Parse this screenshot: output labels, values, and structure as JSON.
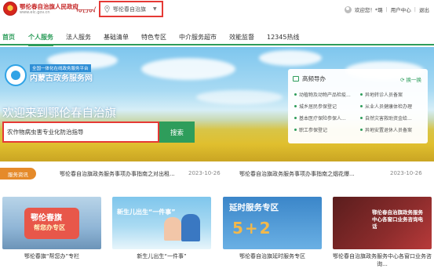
{
  "header": {
    "title": "鄂伦春自治旗人民政府",
    "url": "www.elc.gov.cn",
    "mongol_script": "ᠣᠷᠴᠣᠨ",
    "location": "鄂伦春自治旗",
    "greeting": "欢迎您！*璐",
    "user_center": "用户中心",
    "logout": "退出"
  },
  "nav": {
    "items": [
      "首页",
      "个人服务",
      "法人服务",
      "基础清单",
      "特色专区",
      "中介服务超市",
      "效能监督",
      "12345热线"
    ]
  },
  "banner": {
    "tag": "全国一体化在线政务服务平台",
    "site": "内蒙古政务服务网",
    "welcome": "欢迎来到鄂伦春自治旗",
    "search_value": "农作物病虫害专业化防治指导",
    "search_button": "搜索"
  },
  "guide": {
    "title": "高频导办",
    "switch": "换一换",
    "items": [
      "动植物及动物产品检疫...",
      "异地转诊人员备案",
      "城乡居民参保登记",
      "从业人员健康体检办理",
      "基本医疗保险参保人...",
      "自然灾害救助资金给...",
      "职工参保登记",
      "异地安置退休人员备案"
    ]
  },
  "news": {
    "badge": "服务资讯",
    "items": [
      {
        "title": "鄂伦春自治旗政务服务事项办事指南之对出租...",
        "date": "2023-10-26"
      },
      {
        "title": "鄂伦春自治旗政务服务事项办事指南之烟花爆...",
        "date": "2023-10-26"
      }
    ]
  },
  "cards": [
    {
      "img_title": "鄂伦春旗",
      "img_subtitle": "帮您办专区",
      "caption": "鄂伦春旗“帮您办”专栏"
    },
    {
      "img_title": "新生儿出生“一件事”",
      "img_subtitle": "",
      "caption": "新生儿出生“一件事”"
    },
    {
      "img_title": "延时服务专区",
      "img_subtitle": "5+2",
      "caption": "鄂伦春自治旗延时服务专区"
    },
    {
      "img_title": "鄂伦春自治旗政务服务中心各窗口业务咨询电话",
      "img_subtitle": "",
      "caption": "鄂伦春自治旗政务服务中心各窗口业务咨询..."
    }
  ],
  "colors": {
    "brand_green": "#2e9d5b",
    "highlight_red": "#e53935",
    "news_orange": "#e58a2a",
    "logo_red": "#c62828"
  },
  "icons": [
    "emblem-logo",
    "location-pin-icon",
    "caret-down-icon",
    "user-avatar-icon",
    "guide-icon",
    "refresh-icon"
  ]
}
